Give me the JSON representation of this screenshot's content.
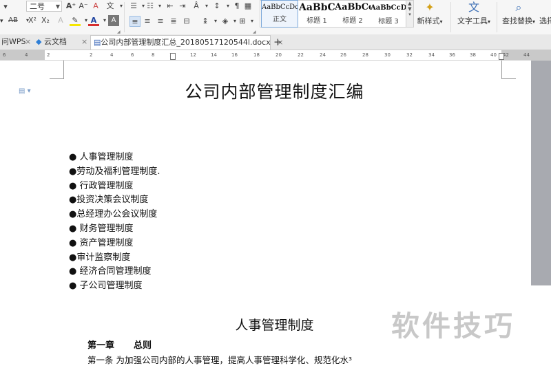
{
  "ribbon": {
    "font_size_value": "二号",
    "grow_font_label": "A⁺",
    "shrink_font_label": "A⁻",
    "clear_format_label": "A",
    "phonetic_label": "文",
    "strike_label": "AB",
    "superscript_label": "X²",
    "subscript_label": "X₂",
    "char_shade_label": "A",
    "font_color_label": "A",
    "char_border_label": "A",
    "font_color_hex": "#d62f2f",
    "highlight_hex": "#f5e600",
    "styles": [
      {
        "preview": "AaBbCcDd",
        "name": "正文"
      },
      {
        "preview": "AaBbC",
        "name": "标题 1"
      },
      {
        "preview": "AaBbCc",
        "name": "标题 2"
      },
      {
        "preview": "AaBbCcDd",
        "name": "标题 3"
      }
    ],
    "new_style_label": "新样式",
    "text_tools_label": "文字工具",
    "find_replace_label": "查找替换",
    "select_label": "选择"
  },
  "tabs": [
    {
      "label": "访问WPS",
      "icon": "wps-icon"
    },
    {
      "label": "云文档",
      "icon": "cloud-doc-icon"
    },
    {
      "label": "公司内部管理制度汇总_20180517120544 1.docx",
      "display": "公司内部管理制度汇总_20180517120544l.docx",
      "icon": "word-doc-icon"
    }
  ],
  "tab_visible": [
    "问WPS",
    "云文档",
    "公司内部管理制度汇总_20180517120544l.docx"
  ],
  "new_tab_label": "+",
  "ruler_numbers": [
    "6",
    "4",
    "2",
    "2",
    "4",
    "6",
    "8",
    "10",
    "12",
    "14",
    "16",
    "18",
    "20",
    "22",
    "24",
    "26",
    "28",
    "30",
    "32",
    "34",
    "36",
    "38",
    "40",
    "42",
    "44"
  ],
  "document": {
    "title": "公司内部管理制度汇编",
    "toc": [
      "●  人事管理制度",
      "●劳动及福利管理制度.",
      "●  行政管理制度",
      "●投资决策会议制度",
      "●总经理办公会议制度",
      "●  财务管理制度",
      "●  资产管理制度",
      "●审计监察制度",
      "●  经济合同管理制度",
      "●  子公司管理制度"
    ],
    "section_title": "人事管理制度",
    "chapter_label": "第一章",
    "chapter_title": "总则",
    "article_text": "第一条 为加强公司内部的人事管理，提高人事管理科学化、规范化水³"
  },
  "watermark": "软件技巧"
}
